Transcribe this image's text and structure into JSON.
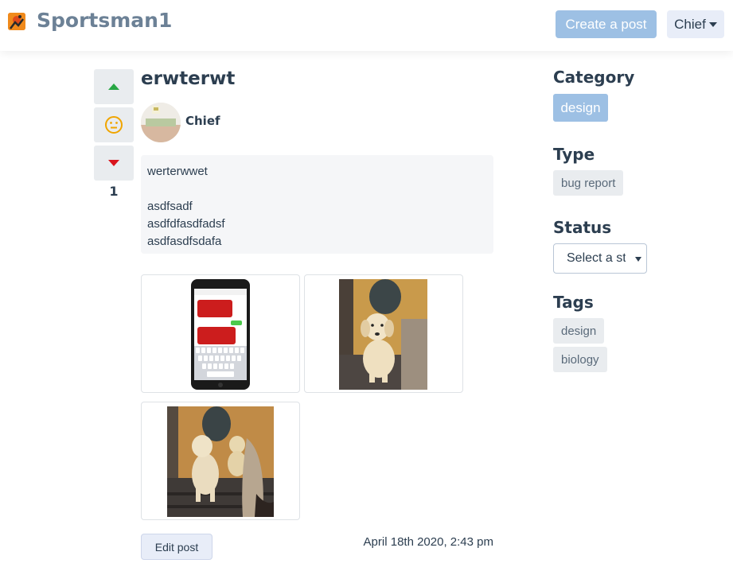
{
  "brand": {
    "name": "Sportsman1",
    "logo_icon": "sportsman-logo-icon"
  },
  "nav": {
    "create_post_label": "Create a post",
    "user_label": "Chief"
  },
  "post": {
    "title": "erwterwt",
    "author": "Chief",
    "votes": "1",
    "body_lines": [
      "werterwwet",
      "",
      "asdfsadf",
      "asdfdfasdfadsf",
      "asdfasdfsdafa"
    ],
    "date": "April 18th 2020, 2:43 pm",
    "edit_label": "Edit post"
  },
  "sidebar": {
    "category_heading": "Category",
    "category": "design",
    "type_heading": "Type",
    "type": "bug report",
    "status_heading": "Status",
    "status_placeholder": "Select a status",
    "tags_heading": "Tags",
    "tags": [
      "design",
      "biology"
    ]
  },
  "colors": {
    "accent": "#9dc0e4",
    "up_vote": "#28a745",
    "down_vote": "#d9141d",
    "neutral_face": "#f0a500",
    "text": "#2c3e50"
  }
}
